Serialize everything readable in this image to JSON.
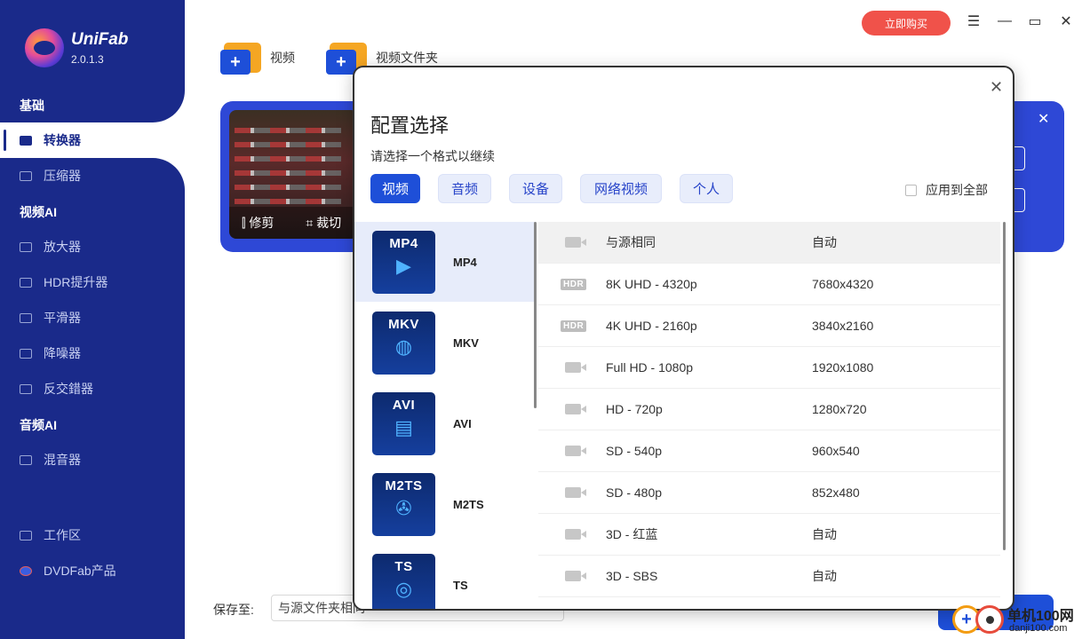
{
  "app": {
    "name": "UniFab",
    "version": "2.0.1.3",
    "buy_label": "立即购买"
  },
  "sidebar": {
    "sections": [
      {
        "title": "基础",
        "items": [
          {
            "label": "转换器",
            "active": true,
            "icon": "convert-icon"
          },
          {
            "label": "压缩器",
            "icon": "compress-icon"
          }
        ]
      },
      {
        "title": "视频AI",
        "items": [
          {
            "label": "放大器",
            "icon": "upscale-icon"
          },
          {
            "label": "HDR提升器",
            "icon": "hdr-icon"
          },
          {
            "label": "平滑器",
            "icon": "smooth-icon"
          },
          {
            "label": "降噪器",
            "icon": "denoise-icon"
          },
          {
            "label": "反交錯器",
            "icon": "deinterlace-icon"
          }
        ]
      },
      {
        "title": "音频AI",
        "items": [
          {
            "label": "混音器",
            "icon": "mixer-icon"
          }
        ]
      }
    ],
    "footer": [
      {
        "label": "工作区",
        "icon": "workspace-icon"
      },
      {
        "label": "DVDFab产品",
        "icon": "dvdfab-icon"
      }
    ]
  },
  "toolbar": {
    "add_video": "视频",
    "add_folder": "视频文件夹"
  },
  "task": {
    "trim": "修剪",
    "crop": "裁切"
  },
  "bottom": {
    "save_to_label": "保存至:",
    "save_to_value": "与源文件夹相同"
  },
  "modal": {
    "title": "配置选择",
    "subtitle": "请选择一个格式以继续",
    "tabs": [
      "视频",
      "音频",
      "设备",
      "网络视频",
      "个人"
    ],
    "active_tab": 0,
    "apply_all": "应用到全部",
    "formats": [
      {
        "tile": "MP4",
        "name": "MP4",
        "glyph": "▶"
      },
      {
        "tile": "MKV",
        "name": "MKV",
        "glyph": "◍"
      },
      {
        "tile": "AVI",
        "name": "AVI",
        "glyph": "▤"
      },
      {
        "tile": "M2TS",
        "name": "M2TS",
        "glyph": "✇"
      },
      {
        "tile": "TS",
        "name": "TS",
        "glyph": "◎"
      }
    ],
    "resolutions": [
      {
        "label": "与源相同",
        "value": "自动",
        "icon": "camera-icon"
      },
      {
        "label": "8K UHD - 4320p",
        "value": "7680x4320",
        "icon": "hdr-badge"
      },
      {
        "label": "4K UHD - 2160p",
        "value": "3840x2160",
        "icon": "hdr-badge"
      },
      {
        "label": "Full HD - 1080p",
        "value": "1920x1080",
        "icon": "camera-icon"
      },
      {
        "label": "HD - 720p",
        "value": "1280x720",
        "icon": "camera-icon"
      },
      {
        "label": "SD - 540p",
        "value": "960x540",
        "icon": "camera-icon"
      },
      {
        "label": "SD - 480p",
        "value": "852x480",
        "icon": "camera-icon"
      },
      {
        "label": "3D - 红蓝",
        "value": "自动",
        "icon": "camera-icon"
      },
      {
        "label": "3D - SBS",
        "value": "自动",
        "icon": "camera-icon"
      }
    ],
    "hdr_text": "HDR"
  },
  "watermark": {
    "site": "单机100网",
    "url": "danji100.com"
  }
}
